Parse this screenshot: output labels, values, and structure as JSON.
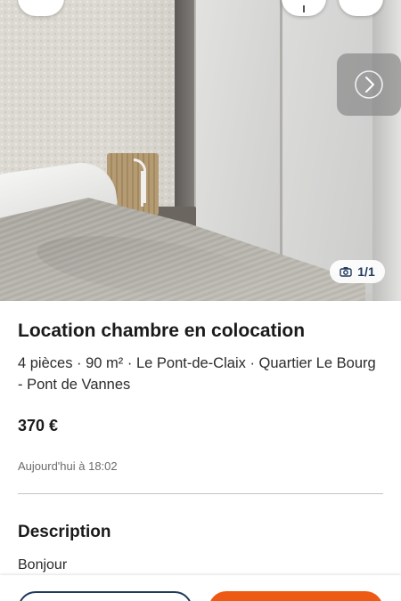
{
  "listing": {
    "title": "Location chambre en colocation",
    "subtitle": "4 pièces · 90 m² · Le Pont-de-Claix · Quartier Le Bourg - Pont de Vannes",
    "price": "370 €",
    "date": "Aujourd'hui à 18:02"
  },
  "gallery": {
    "counter": "1/1",
    "camera_icon": "camera-icon",
    "next_icon": "chevron-right-icon"
  },
  "description": {
    "heading": "Description",
    "text": "Bonjour"
  },
  "colors": {
    "accent": "#ec5a13",
    "navy": "#1f3a5f"
  }
}
